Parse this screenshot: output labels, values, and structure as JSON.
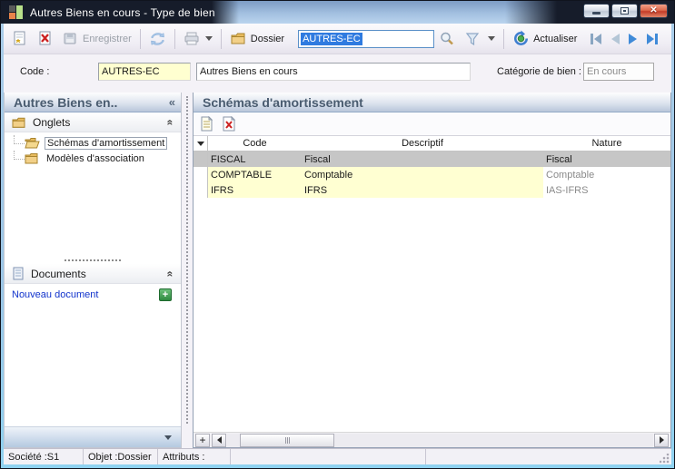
{
  "window": {
    "title": "Autres Biens en cours -  Type de bien"
  },
  "icons": {
    "close_glyph": "✕",
    "collapse_left_glyph": "«",
    "collapse_up_glyph": "«",
    "plus_glyph": "+",
    "scroll_plus_glyph": "+"
  },
  "toolbar": {
    "save_label": "Enregistrer",
    "dossier_label": "Dossier",
    "code_value": "AUTRES-EC",
    "refresh_label": "Actualiser"
  },
  "form": {
    "code_label": "Code :",
    "code_value": "AUTRES-EC",
    "description_value": "Autres Biens en cours",
    "category_label": "Catégorie de bien :",
    "category_value": "En cours"
  },
  "left_panel": {
    "title": "Autres Biens en..",
    "onglets_label": "Onglets",
    "documents_label": "Documents",
    "tree": [
      {
        "label": "Schémas d'amortissement"
      },
      {
        "label": "Modèles d'association"
      }
    ],
    "new_document_label": "Nouveau document"
  },
  "main_panel": {
    "title": "Schémas d'amortissement",
    "table": {
      "columns": [
        "Code",
        "Descriptif",
        "Nature"
      ],
      "rows": [
        {
          "code": "FISCAL",
          "descriptif": "Fiscal",
          "nature": "Fiscal"
        },
        {
          "code": "COMPTABLE",
          "descriptif": "Comptable",
          "nature": "Comptable"
        },
        {
          "code": "IFRS",
          "descriptif": "IFRS",
          "nature": "IAS-IFRS"
        }
      ]
    }
  },
  "status_bar": {
    "societe": "Société :S1",
    "objet": "Objet :Dossier",
    "attributs": "Attributs :"
  },
  "colors": {
    "accent_blue": "#3a86e0",
    "row_selected": "#c6c6c6",
    "row_editable": "#ffffd2",
    "link": "#1133cc",
    "close_red": "#c43c28",
    "title_dark": "#161c2a"
  }
}
